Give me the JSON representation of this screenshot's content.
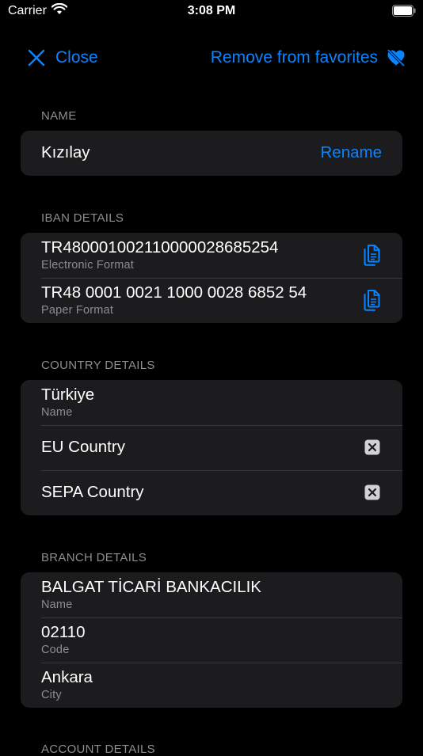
{
  "status": {
    "carrier": "Carrier",
    "time": "3:08 PM"
  },
  "nav": {
    "close_label": "Close",
    "favorites_label": "Remove from favorites"
  },
  "name_section": {
    "header": "NAME",
    "value": "Kızılay",
    "rename_label": "Rename"
  },
  "iban_section": {
    "header": "IBAN DETAILS",
    "electronic": {
      "value": "TR480001002110000028685254",
      "label": "Electronic Format"
    },
    "paper": {
      "value": "TR48 0001 0021 1000 0028 6852 54",
      "label": "Paper Format"
    }
  },
  "country_section": {
    "header": "COUNTRY DETAILS",
    "name": {
      "value": "Türkiye",
      "label": "Name"
    },
    "eu": {
      "label": "EU Country"
    },
    "sepa": {
      "label": "SEPA Country"
    }
  },
  "branch_section": {
    "header": "BRANCH DETAILS",
    "name": {
      "value": "BALGAT TİCARİ BANKACILIK",
      "label": "Name"
    },
    "code": {
      "value": "02110",
      "label": "Code"
    },
    "city": {
      "value": "Ankara",
      "label": "City"
    }
  },
  "account_section": {
    "header": "ACCOUNT DETAILS"
  },
  "colors": {
    "accent": "#0a84ff",
    "background": "#000000",
    "card": "#1c1c1e",
    "secondary_text": "#8d8d92"
  },
  "icons": [
    "wifi-icon",
    "battery-icon",
    "close-icon",
    "heart-slash-icon",
    "copy-icon",
    "xmark-square-icon"
  ]
}
